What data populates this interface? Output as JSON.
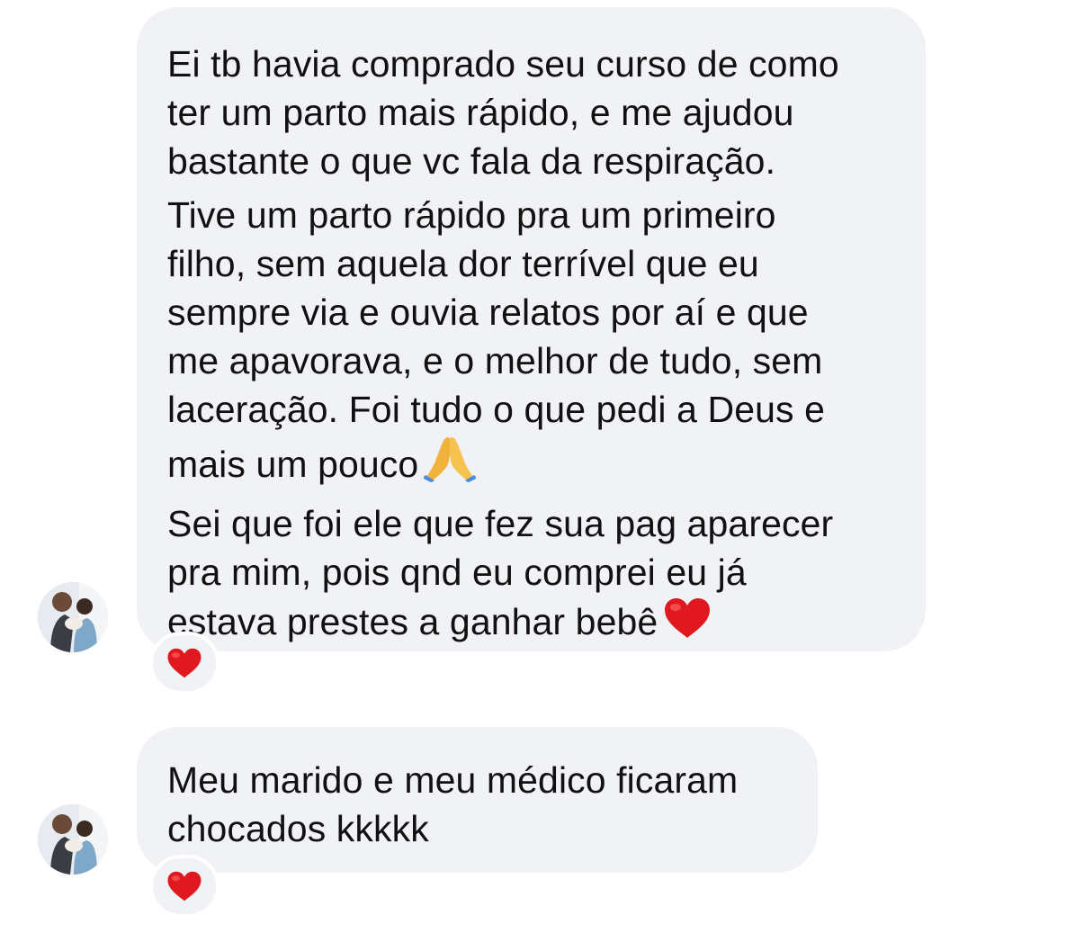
{
  "conversation": {
    "messages": [
      {
        "paragraphs": [
          "Ei tb havia comprado seu curso de como\nter um parto mais rápido, e me ajudou\nbastante o que vc fala da respiração.",
          "Tive um parto rápido pra um primeiro\nfilho, sem aquela dor terrível que eu\nsempre via e ouvia relatos por aí e que\nme apavorava, e o melhor de tudo, sem\nlaceração. Foi tudo o que pedi a Deus e\nmais um pouco",
          "Sei que foi ele que fez sua pag aparecer\npra mim, pois qnd eu comprei eu já\nestava prestes a ganhar bebê"
        ],
        "emojis": [
          "praying-hands-icon",
          "red-heart-icon"
        ],
        "reaction": "red-heart-icon"
      },
      {
        "paragraphs": [
          "Meu marido e meu médico ficaram\nchocados kkkkk"
        ],
        "reaction": "red-heart-icon"
      }
    ]
  },
  "colors": {
    "bubble_background": "#f1f2f6",
    "text": "#111111",
    "heart": "#e0181f",
    "background": "#ffffff"
  }
}
